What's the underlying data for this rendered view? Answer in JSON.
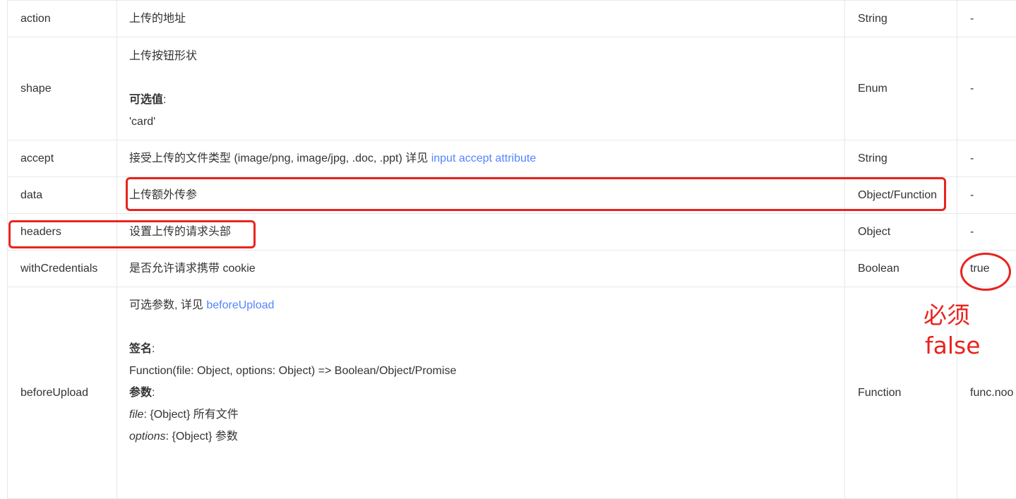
{
  "rows": [
    {
      "name": "action",
      "desc": "上传的地址",
      "type": "String",
      "default": "-"
    },
    {
      "name": "shape",
      "desc_title": "上传按钮形状",
      "optional_label": "可选值",
      "optional_value": "'card'",
      "type": "Enum",
      "default": "-"
    },
    {
      "name": "accept",
      "desc_prefix": "接受上传的文件类型 (image/png, image/jpg, .doc, .ppt) 详见 ",
      "desc_link": "input accept attribute",
      "type": "String",
      "default": "-"
    },
    {
      "name": "data",
      "desc": "上传额外传参",
      "type": "Object/Function",
      "default": "-"
    },
    {
      "name": "headers",
      "desc": "设置上传的请求头部",
      "type": "Object",
      "default": "-"
    },
    {
      "name": "withCredentials",
      "desc": "是否允许请求携带 cookie",
      "type": "Boolean",
      "default": "true"
    },
    {
      "name": "beforeUpload",
      "desc_prefix": "可选参数, 详见 ",
      "desc_link": "beforeUpload",
      "sig_label": "签名",
      "sig_value": "Function(file: Object, options: Object) => Boolean/Object/Promise",
      "params_label": "参数",
      "param1_name": "file",
      "param1_desc": " {Object} 所有文件",
      "param2_name": "options",
      "param2_desc": " {Object} 参数",
      "type": "Function",
      "default": "func.noo"
    }
  ],
  "annotation": {
    "line1": "必须",
    "line2": "false",
    "color": "#e8241f"
  }
}
